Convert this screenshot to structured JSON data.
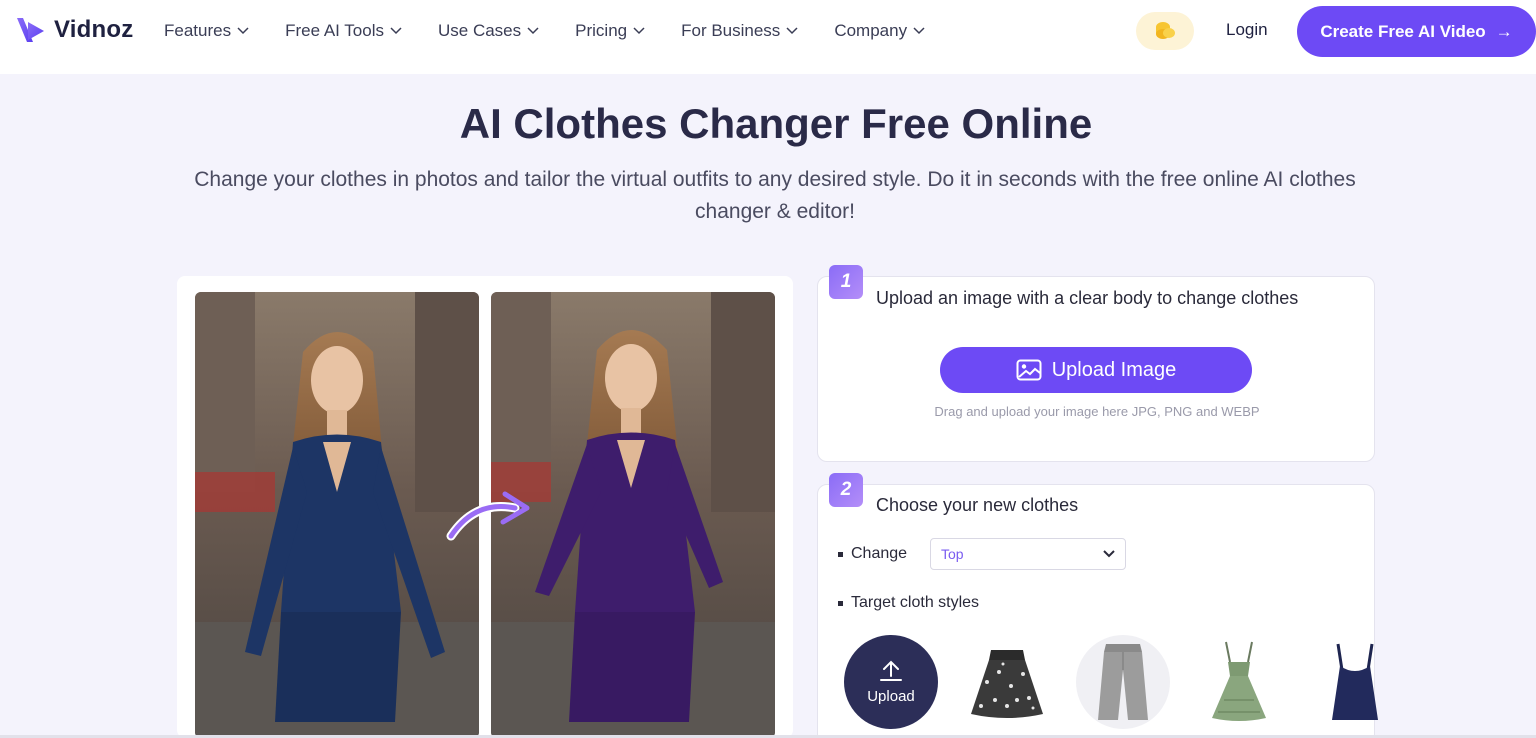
{
  "nav": {
    "logo_text": "Vidnoz",
    "menu": [
      {
        "label": "Features"
      },
      {
        "label": "Free AI Tools"
      },
      {
        "label": "Use Cases"
      },
      {
        "label": "Pricing"
      },
      {
        "label": "For Business"
      },
      {
        "label": "Company"
      }
    ],
    "coin_icon": "coin-stack-icon",
    "login_label": "Login",
    "cta_label": "Create Free AI Video",
    "cta_arrow": "→"
  },
  "hero": {
    "title": "AI Clothes Changer Free Online",
    "subtitle": "Change your clothes in photos and tailor the virtual outfits to any desired style. Do it in seconds with the free online AI clothes changer & editor!"
  },
  "step1": {
    "number": "1",
    "title": "Upload an image with a clear body to change clothes",
    "upload_label": "Upload Image",
    "drag_hint": "Drag and upload your image here JPG, PNG and WEBP"
  },
  "step2": {
    "number": "2",
    "title": "Choose your new clothes",
    "change_label": "Change",
    "change_value": "Top",
    "styles_label": "Target cloth styles",
    "upload_label": "Upload",
    "cloth_icons": [
      "floral-skirt-icon",
      "gray-jeans-icon",
      "green-dress-icon",
      "navy-tank-top-icon"
    ]
  },
  "colors": {
    "accent": "#6d4af5",
    "dark_navy": "#2c2e58",
    "background": "#f4f3fc"
  }
}
